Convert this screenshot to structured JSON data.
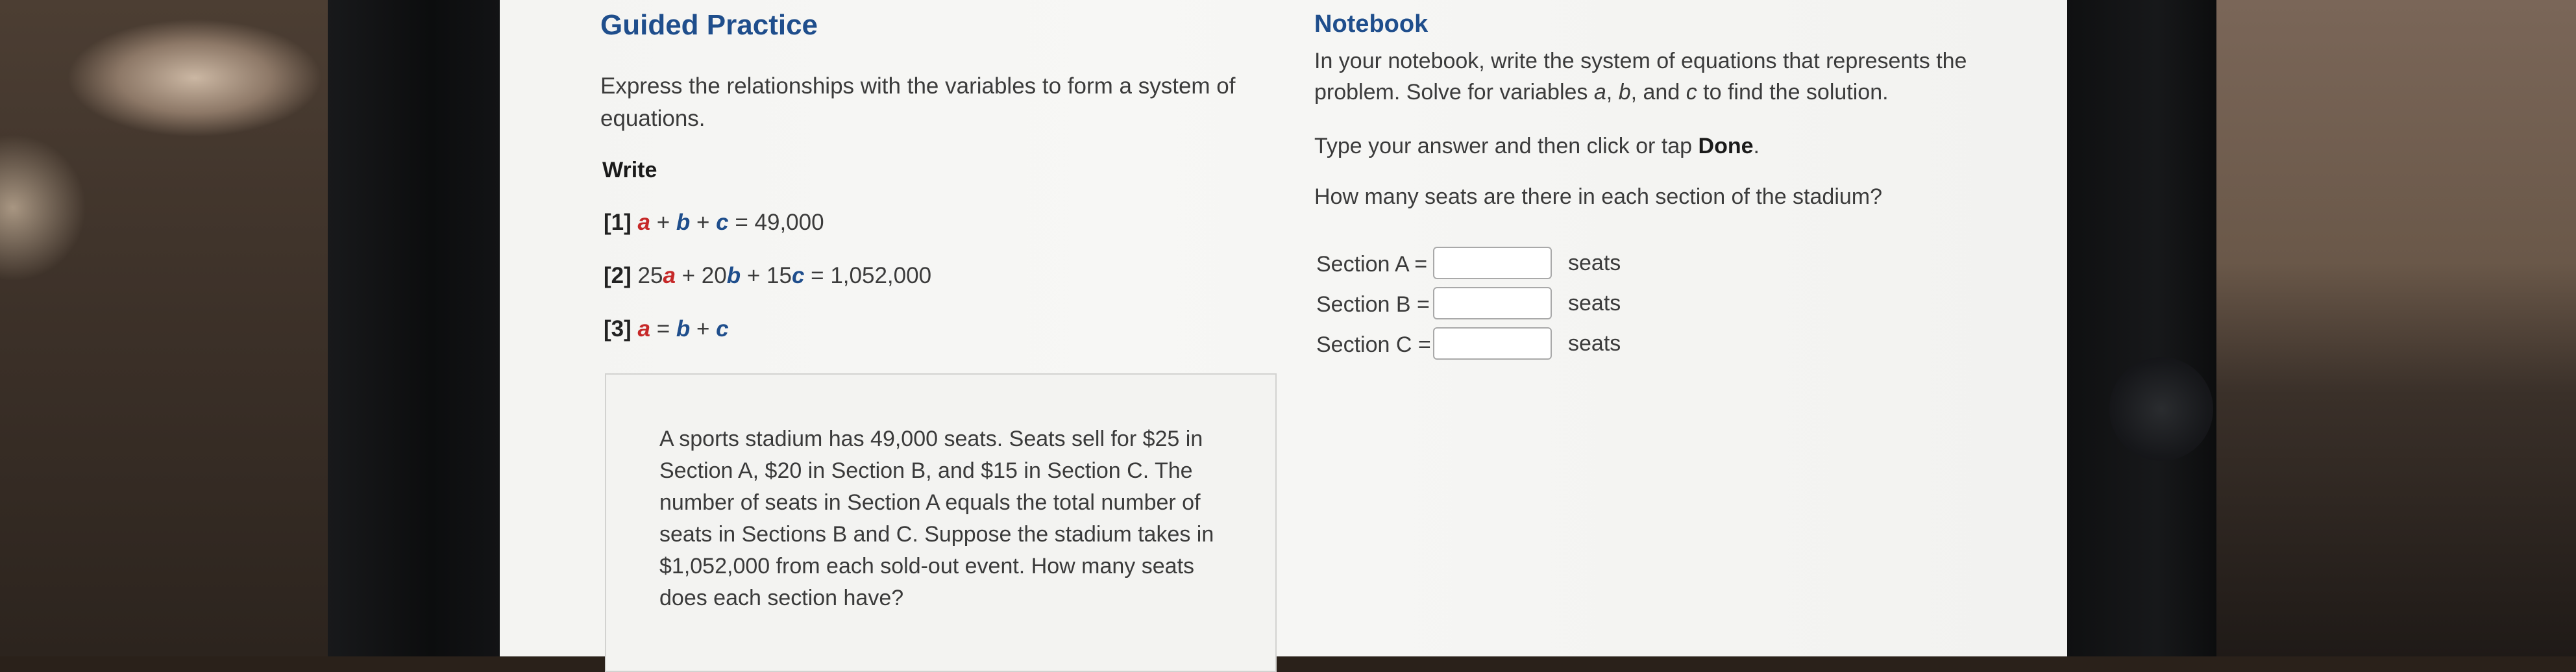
{
  "guided": {
    "title": "Guided Practice",
    "instructions": "Express the relationships with the variables to form a system of equations.",
    "write_label": "Write",
    "equations": [
      {
        "num": "[1]",
        "parts": [
          "a",
          " + ",
          "b",
          " + ",
          "c",
          " = 49,000"
        ]
      },
      {
        "num": "[2]",
        "parts": [
          "25",
          "a",
          " + 20",
          "b",
          " + 15",
          "c",
          " = 1,052,000"
        ]
      },
      {
        "num": "[3]",
        "parts": [
          "a",
          " = ",
          "b",
          " + ",
          "c"
        ]
      }
    ],
    "problem": "A sports stadium has 49,000 seats. Seats sell for $25 in Section A, $20 in Section B, and $15 in Section C. The number of seats in Section A equals the total number of seats in Sections B and C. Suppose the stadium takes in $1,052,000 from each sold-out event. How many seats does each section have?"
  },
  "notebook": {
    "title": "Notebook",
    "instructions_1": "In your notebook, write the system of equations that represents the problem. Solve for variables ",
    "var_a": "a",
    "sep1": ", ",
    "var_b": "b",
    "sep2": ", and ",
    "var_c": "c",
    "instructions_2": " to find the solution.",
    "type_prefix": "Type your answer and then click or tap ",
    "done_word": "Done",
    "type_suffix": ".",
    "question": "How many seats are there in each section of the stadium?",
    "answers": [
      {
        "label": "Section A =",
        "value": "",
        "unit": "seats"
      },
      {
        "label": "Section B =",
        "value": "",
        "unit": "seats"
      },
      {
        "label": "Section C =",
        "value": "",
        "unit": "seats"
      }
    ]
  }
}
